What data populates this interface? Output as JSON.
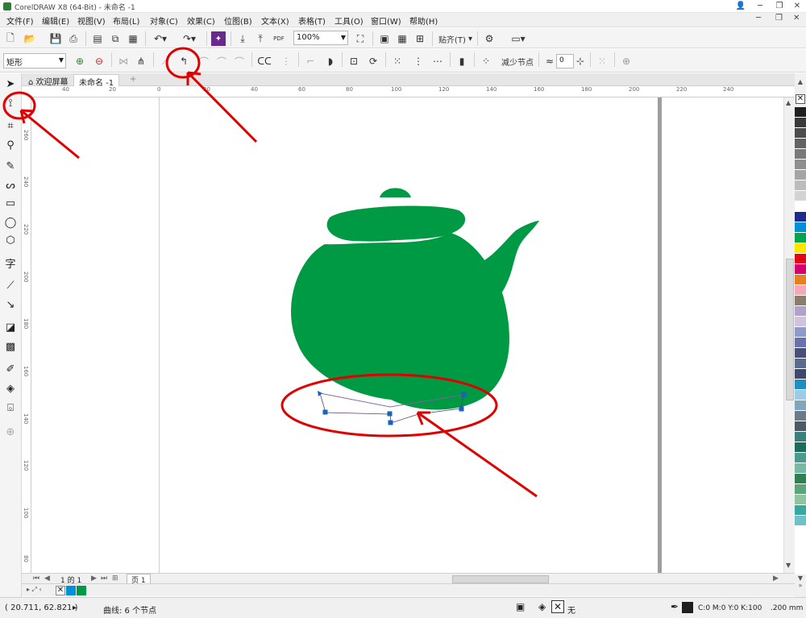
{
  "window": {
    "title": "CorelDRAW X8 (64-Bit) - 未命名 -1"
  },
  "menu": [
    "文件(F)",
    "编辑(E)",
    "视图(V)",
    "布局(L)",
    "对象(C)",
    "效果(C)",
    "位图(B)",
    "文本(X)",
    "表格(T)",
    "工具(O)",
    "窗口(W)",
    "帮助(H)"
  ],
  "toolbar": {
    "zoom": "100%",
    "snap_label": "贴齐(T)",
    "pdf_label": "PDF"
  },
  "propbar": {
    "shape_select": "矩形",
    "reduce_nodes_label": "减少节点",
    "smoothness_value": "0"
  },
  "tabs": {
    "welcome": "欢迎屏幕",
    "doc": "未命名 -1",
    "add": "+"
  },
  "ruler": {
    "h_labels": [
      "40",
      "20",
      "0",
      "20",
      "40",
      "60",
      "80",
      "100",
      "120",
      "140",
      "160",
      "180",
      "200",
      "220",
      "240"
    ],
    "v_labels": [
      "260",
      "240",
      "220",
      "200",
      "180",
      "160",
      "140",
      "120",
      "100",
      "80",
      "60"
    ]
  },
  "pagebar": {
    "counter": "1 的 1",
    "page_tab": "页 1"
  },
  "palette_colors": [
    "#231f20",
    "#3a3a3a",
    "#4d4d4d",
    "#636363",
    "#7a7a7a",
    "#8f8f8f",
    "#a5a5a5",
    "#bcbcbc",
    "#d3d3d3",
    "#ffffff",
    "#1e2a8c",
    "#0090d8",
    "#00a44f",
    "#ffe600",
    "#e30613",
    "#d5006d",
    "#e67e22",
    "#f4a8b8",
    "#8b7d6b",
    "#b0a2c8",
    "#cfc3e0",
    "#8e9cc7",
    "#6a72ad",
    "#4a4f7a",
    "#5b6a8f",
    "#3d4a6b",
    "#1f8fc1",
    "#9ccbe6",
    "#7fa6bd",
    "#6b7b8c",
    "#4c5a63",
    "#3b7f7a",
    "#1e6b5b",
    "#4e9a88",
    "#79b8a5",
    "#2f7f52",
    "#5fa37a",
    "#8cc5a0",
    "#3aa6a0",
    "#6fc1c8"
  ],
  "docpalette": [
    "#0090d8",
    "#009944"
  ],
  "statusbar": {
    "coords": "( 20.711, 62.821 )",
    "arrow": "▸",
    "info": "曲线: 6 个节点",
    "fill_none": "无",
    "outline_color": "C:0 M:0 Y:0 K:100",
    "outline_width": ".200 mm"
  },
  "colors": {
    "teapot": "#009944",
    "annotation": "#e00000",
    "node": "#1565c0"
  }
}
